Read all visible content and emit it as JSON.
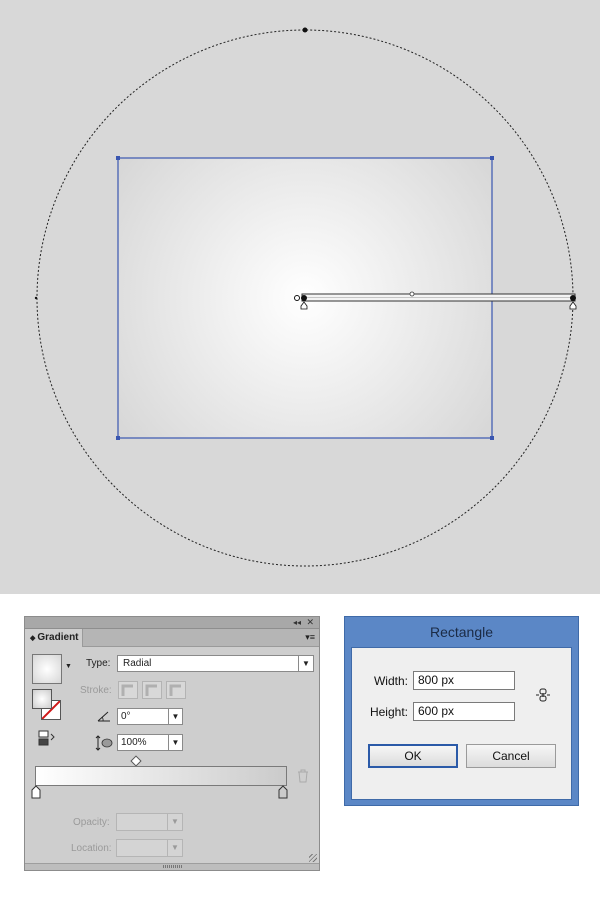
{
  "gradient_panel": {
    "tab_label": "Gradient",
    "collapse_icon": "double-left-arrow",
    "close_icon": "x",
    "type_label": "Type:",
    "type_value": "Radial",
    "stroke_label": "Stroke:",
    "angle_value": "0°",
    "aspect_value": "100%",
    "opacity_label": "Opacity:",
    "location_label": "Location:"
  },
  "dialog": {
    "title": "Rectangle",
    "width_label": "Width:",
    "width_value": "800 px",
    "height_label": "Height:",
    "height_value": "600 px",
    "ok_label": "OK",
    "cancel_label": "Cancel"
  },
  "colors": {
    "artboard_bg": "#d8d8d8",
    "selection_blue": "#3a56b0",
    "dialog_frame": "#5b87c6"
  }
}
